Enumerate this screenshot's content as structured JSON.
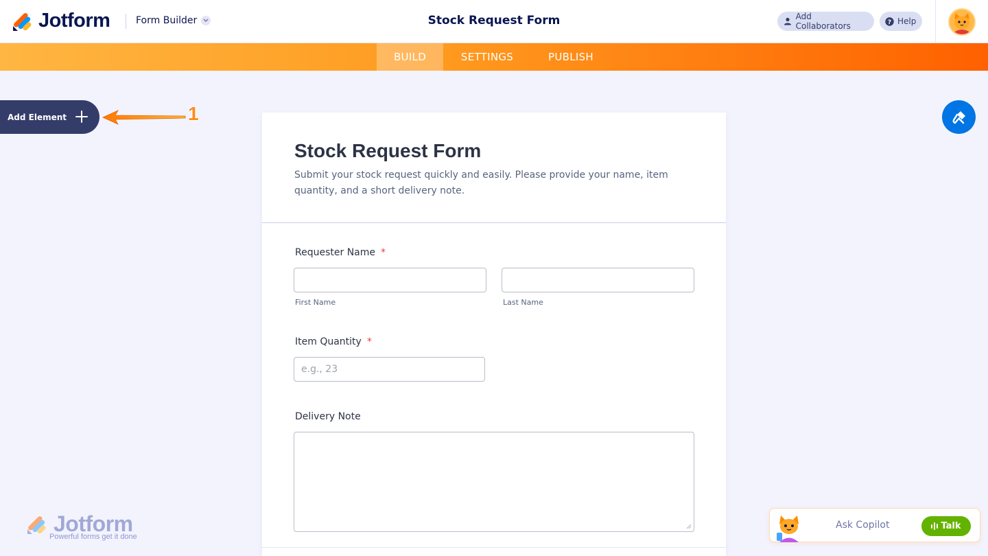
{
  "header": {
    "brand": "Jotform",
    "form_builder_label": "Form Builder",
    "title": "Stock Request Form",
    "add_collaborators_label": "Add Collaborators",
    "help_label": "Help"
  },
  "nav": {
    "tabs": [
      {
        "label": "BUILD",
        "active": true
      },
      {
        "label": "SETTINGS",
        "active": false
      },
      {
        "label": "PUBLISH",
        "active": false
      }
    ]
  },
  "sidebar": {
    "add_element_label": "Add Element",
    "annotation_number": "1"
  },
  "form": {
    "title": "Stock Request Form",
    "description": "Submit your stock request quickly and easily. Please provide your name, item quantity, and a short delivery note.",
    "fields": {
      "requester_name": {
        "label": "Requester Name",
        "required_marker": "*",
        "first_value": "",
        "last_value": "",
        "first_sublabel": "First Name",
        "last_sublabel": "Last Name"
      },
      "item_quantity": {
        "label": "Item Quantity",
        "required_marker": "*",
        "value": "",
        "placeholder": "e.g., 23"
      },
      "delivery_note": {
        "label": "Delivery Note",
        "value": ""
      }
    }
  },
  "watermark": {
    "brand": "Jotform",
    "tagline": "Powerful forms get it done"
  },
  "copilot": {
    "placeholder": "Ask Copilot",
    "talk_label": "Talk"
  },
  "colors": {
    "primary_dark": "#0a1551",
    "accent_orange": "#ff6100",
    "accent_blue": "#0075e3",
    "talk_green": "#64b200",
    "required_red": "#f23a3c"
  }
}
